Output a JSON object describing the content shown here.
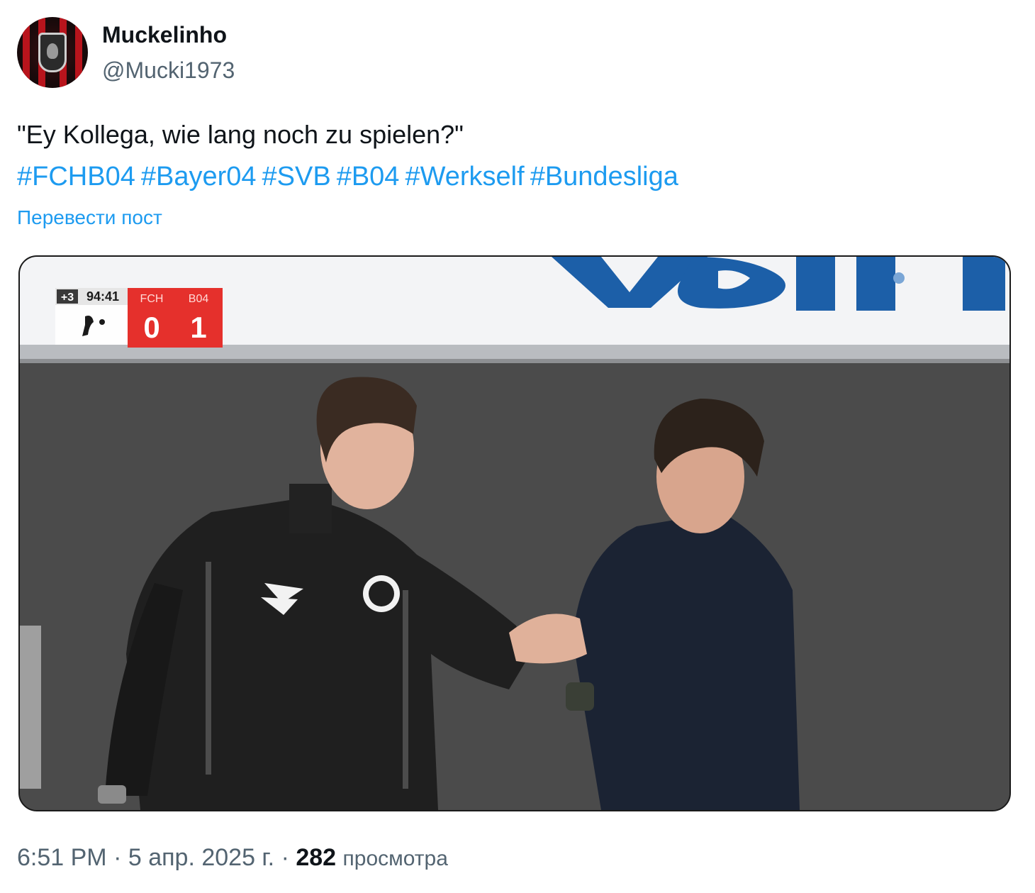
{
  "author": {
    "name": "Muckelinho",
    "handle": "@Mucki1973",
    "avatar_icon": "avatar-image"
  },
  "tweet": {
    "text": "\"Ey Kollega, wie lang noch zu spielen?\"",
    "hashtags": [
      "#FCHB04",
      "#Bayer04",
      "#SVB",
      "#B04",
      "#Werkself",
      "#Bundesliga"
    ],
    "translate_link": "Перевести пост"
  },
  "media": {
    "scoreboard": {
      "added_time": "+3",
      "clock": "94:41",
      "home_team": "FCH",
      "away_team": "B04",
      "home_score": "0",
      "away_score": "1"
    }
  },
  "footer": {
    "time": "6:51 PM",
    "separator": "·",
    "date": "5 апр. 2025 г.",
    "views_count": "282",
    "views_label": "просмотра"
  },
  "colors": {
    "link": "#1d9bf0",
    "text_primary": "#0f1419",
    "text_secondary": "#536471",
    "scoreboard_red": "#e5302c"
  }
}
